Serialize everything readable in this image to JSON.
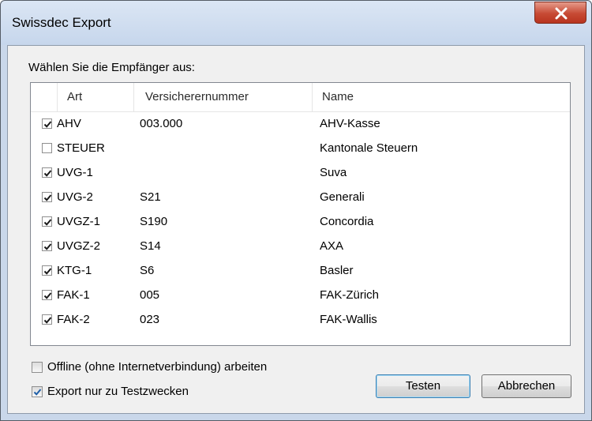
{
  "window": {
    "title": "Swissdec Export"
  },
  "prompt": "Wählen Sie die Empfänger aus:",
  "list": {
    "columns": [
      "Art",
      "Versicherernummer",
      "Name"
    ],
    "rows": [
      {
        "checked": true,
        "art": "AHV",
        "nummer": "003.000",
        "name": "AHV-Kasse"
      },
      {
        "checked": false,
        "art": "STEUER",
        "nummer": "",
        "name": "Kantonale Steuern"
      },
      {
        "checked": true,
        "art": "UVG-1",
        "nummer": "",
        "name": "Suva"
      },
      {
        "checked": true,
        "art": "UVG-2",
        "nummer": "S21",
        "name": "Generali"
      },
      {
        "checked": true,
        "art": "UVGZ-1",
        "nummer": "S190",
        "name": "Concordia"
      },
      {
        "checked": true,
        "art": "UVGZ-2",
        "nummer": "S14",
        "name": "AXA"
      },
      {
        "checked": true,
        "art": "KTG-1",
        "nummer": "S6",
        "name": "Basler"
      },
      {
        "checked": true,
        "art": "FAK-1",
        "nummer": "005",
        "name": "FAK-Zürich"
      },
      {
        "checked": true,
        "art": "FAK-2",
        "nummer": "023",
        "name": "FAK-Wallis"
      }
    ]
  },
  "options": {
    "offline": {
      "label": "Offline (ohne Internetverbindung) arbeiten",
      "checked": false
    },
    "test": {
      "label": "Export nur zu Testzwecken",
      "checked": true
    }
  },
  "buttons": {
    "test": "Testen",
    "cancel": "Abbrechen"
  },
  "colors": {
    "close_button": "#c74a34",
    "check_blue": "#1e5fa8"
  }
}
